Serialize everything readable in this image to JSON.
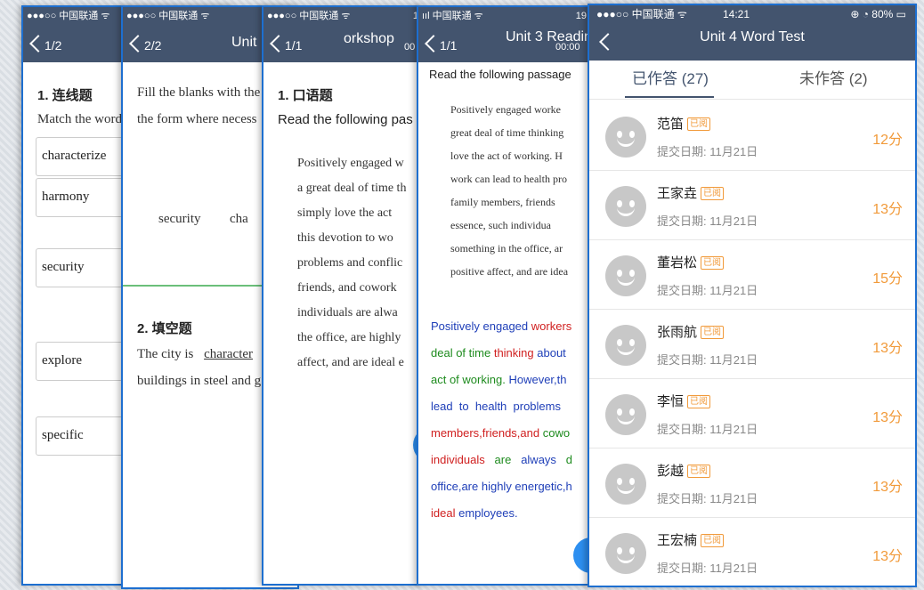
{
  "screen1": {
    "status": "●●●○○ 中国联通 ᯤ",
    "pager": "1/2",
    "section_title": "1. 连线题",
    "instruction": "Match the word",
    "words": [
      "characterize",
      "harmony",
      "security",
      "explore",
      "specific"
    ]
  },
  "screen2": {
    "status": "●●●○○ 中国联通 ᯤ",
    "pager": "2/2",
    "title": "Unit",
    "instruction_line1": "Fill the blanks with the",
    "instruction_line2": "the form where necess",
    "word1": "security",
    "word2": "cha",
    "section2_title": "2. 填空题",
    "sentence_prefix": "The city is",
    "blank_answer": "character",
    "sentence_line2": "buildings in steel and g"
  },
  "screen3": {
    "status": "●●●○○ 中国联通 ᯤ",
    "status_right": "1",
    "pager": "1/1",
    "title": "orkshop",
    "timer": "00",
    "section_title": "1. 口语题",
    "instruction": "Read the following pas",
    "passage": [
      "Positively engaged w",
      "a great deal of time th",
      "simply love the act",
      "this devotion to wo",
      "problems and conflic",
      "friends, and cowork",
      "individuals are alwa",
      "the office, are highly",
      "affect, and are ideal e"
    ]
  },
  "screen4": {
    "status": "ııl 中国联通 ᯤ",
    "status_right": "19:",
    "pager": "1/1",
    "title": "Unit 3 Readin",
    "timer": "00:00",
    "instruction": "Read the following passage",
    "passage": [
      "Positively engaged worke",
      "great deal of time thinking",
      "love the act of working. H",
      "work can lead to health pro",
      "family members, friends",
      "essence, such individua",
      "something in the office, ar",
      "positive affect, and are idea"
    ],
    "colored": {
      "l1a": "Positively engaged",
      "l1b": "workers",
      "l2a": "deal of time",
      "l2b": "thinking",
      "l2c": "about",
      "l3a": "act of working.",
      "l3b": "However,th",
      "l4": "lead  to  health  problems",
      "l5a": "members,friends,and",
      "l5b": "cowo",
      "l6a": "individuals",
      "l6b": "are",
      "l6c": "always",
      "l6d": "d",
      "l7a": "office,are highly energetic,h",
      "l8a": "ideal",
      "l8b": "employees."
    }
  },
  "screen5": {
    "status_left": "●●●○○ 中国联通 ᯤ",
    "status_time": "14:21",
    "status_right": "⊕ ◔ 80% ▭",
    "title": "Unit 4 Word Test",
    "tab_answered": "已作答 (27)",
    "tab_unanswered": "未作答 (2)",
    "badge": "已阅",
    "students": [
      {
        "name": "范笛",
        "date": "提交日期: 11月21日",
        "score": "12分"
      },
      {
        "name": "王家垚",
        "date": "提交日期: 11月21日",
        "score": "13分"
      },
      {
        "name": "董岩松",
        "date": "提交日期: 11月21日",
        "score": "15分"
      },
      {
        "name": "张雨航",
        "date": "提交日期: 11月21日",
        "score": "13分"
      },
      {
        "name": "李恒",
        "date": "提交日期: 11月21日",
        "score": "13分"
      },
      {
        "name": "彭越",
        "date": "提交日期: 11月21日",
        "score": "13分"
      },
      {
        "name": "王宏楠",
        "date": "提交日期: 11月21日",
        "score": "13分"
      }
    ]
  }
}
